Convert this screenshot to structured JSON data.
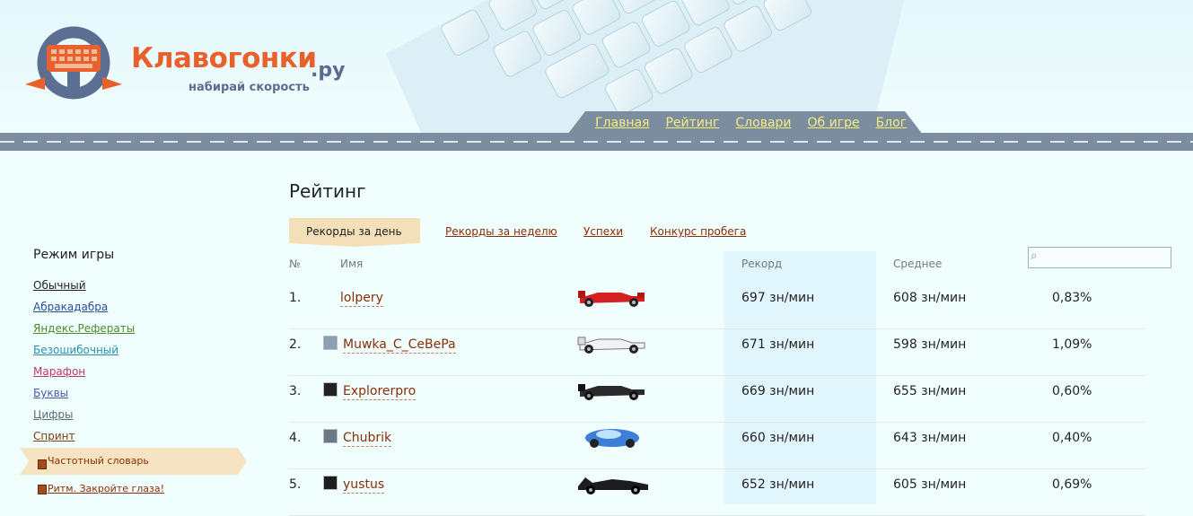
{
  "header": {
    "brand": "Клавогонки",
    "brand_domain": ".ру",
    "slogan": "набирай скорость",
    "nav": [
      "Главная",
      "Рейтинг",
      "Словари",
      "Об игре",
      "Блог"
    ]
  },
  "sidebar": {
    "title": "Режим игры",
    "modes": [
      {
        "label": "Обычный",
        "color": "#222222"
      },
      {
        "label": "Абракадабра",
        "color": "#2a4a9a"
      },
      {
        "label": "Яндекс.Рефераты",
        "color": "#4f8a2a"
      },
      {
        "label": "Безошибочный",
        "color": "#2c8fae"
      },
      {
        "label": "Марафон",
        "color": "#c0366c"
      },
      {
        "label": "Буквы",
        "color": "#4a5aa8"
      },
      {
        "label": "Цифры",
        "color": "#5a6a78"
      },
      {
        "label": "Спринт",
        "color": "#7a3c10"
      }
    ],
    "active_vocab": "Частотный словарь",
    "sub_vocab": "Ритм. Закройте глаза!"
  },
  "main": {
    "title": "Рейтинг",
    "tabs": [
      "Рекорды за день",
      "Рекорды за неделю",
      "Успехи",
      "Конкурс пробега"
    ],
    "columns": {
      "num": "№",
      "name": "Имя",
      "record": "Рекорд",
      "average": "Среднее"
    },
    "search_icon": "magnifier-icon",
    "rows": [
      {
        "rank": "1.",
        "name": "lolpery",
        "record": "697 зн/мин",
        "average": "608 зн/мин",
        "errors": "0,83%",
        "car": "red-formula"
      },
      {
        "rank": "2.",
        "name": "Muwka_C_CeBePa",
        "record": "671 зн/мин",
        "average": "598 зн/мин",
        "errors": "1,09%",
        "car": "white-formula"
      },
      {
        "rank": "3.",
        "name": "Explorerpro",
        "record": "669 зн/мин",
        "average": "655 зн/мин",
        "errors": "0,60%",
        "car": "black-formula"
      },
      {
        "rank": "4.",
        "name": "Chubrik",
        "record": "660 зн/мин",
        "average": "643 зн/мин",
        "errors": "0,40%",
        "car": "blue-concept"
      },
      {
        "rank": "5.",
        "name": "yustus",
        "record": "652 зн/мин",
        "average": "605 зн/мин",
        "errors": "0,69%",
        "car": "batmobile"
      }
    ]
  },
  "colors": {
    "accent": "#e8612c",
    "link": "#8a2e08",
    "nav_link": "#f6ee7a",
    "road": "#7d8da0",
    "record_bg": "#e1f6fc"
  }
}
